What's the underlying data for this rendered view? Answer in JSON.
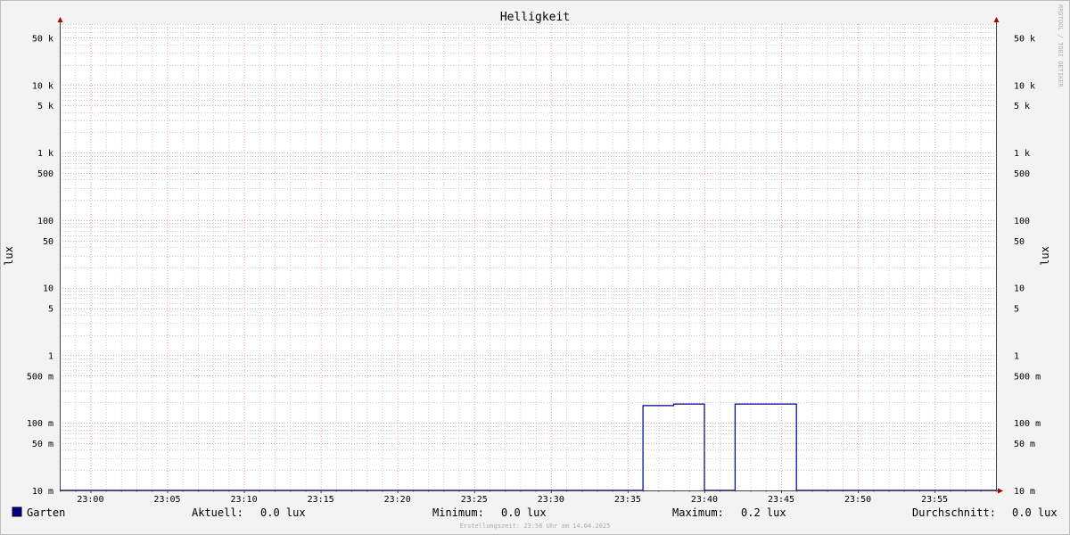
{
  "chart_data": {
    "type": "line",
    "title": "Helligkeit",
    "ylabel_left": "lux",
    "ylabel_right": "lux",
    "y_scale": "log",
    "ylim": [
      0.01,
      80000
    ],
    "xlim": [
      "22:58",
      "23:59"
    ],
    "x_tick_labels": [
      "23:00",
      "23:05",
      "23:10",
      "23:15",
      "23:20",
      "23:25",
      "23:30",
      "23:35",
      "23:40",
      "23:45",
      "23:50",
      "23:55"
    ],
    "y_tick_labels": [
      {
        "value": 50000,
        "label": "50 k"
      },
      {
        "value": 10000,
        "label": "10 k"
      },
      {
        "value": 5000,
        "label": "5 k"
      },
      {
        "value": 1000,
        "label": "1 k"
      },
      {
        "value": 500,
        "label": "500"
      },
      {
        "value": 100,
        "label": "100"
      },
      {
        "value": 50,
        "label": "50"
      },
      {
        "value": 10,
        "label": "10"
      },
      {
        "value": 5,
        "label": "5"
      },
      {
        "value": 1,
        "label": "1"
      },
      {
        "value": 0.5,
        "label": "500 m"
      },
      {
        "value": 0.1,
        "label": "100 m"
      },
      {
        "value": 0.05,
        "label": "50 m"
      },
      {
        "value": 0.01,
        "label": "10 m"
      }
    ],
    "series": [
      {
        "name": "Garten",
        "color": "#00008b",
        "points": [
          [
            "22:58",
            0
          ],
          [
            "23:36",
            0
          ],
          [
            "23:36",
            0.18
          ],
          [
            "23:38",
            0.18
          ],
          [
            "23:38",
            0.19
          ],
          [
            "23:40",
            0.19
          ],
          [
            "23:40",
            0
          ],
          [
            "23:42",
            0
          ],
          [
            "23:42",
            0.19
          ],
          [
            "23:46",
            0.19
          ],
          [
            "23:46",
            0
          ],
          [
            "23:59",
            0
          ]
        ]
      }
    ],
    "grid": true
  },
  "watermark": "RRDTOOL / TOBI OETIKER",
  "legend": {
    "series_name": "Garten",
    "aktuell_label": "Aktuell:",
    "aktuell_value": "0.0 lux",
    "minimum_label": "Minimum:",
    "minimum_value": "0.0 lux",
    "maximum_label": "Maximum:",
    "maximum_value": "0.2 lux",
    "durchschnitt_label": "Durchschnitt:",
    "durchschnitt_value": "0.0 lux"
  },
  "footer": "Erstellungszeit: 23:58 Uhr am 14.04.2025",
  "colors": {
    "background": "#f3f3f3",
    "canvas": "#ffffff",
    "major_grid": "#e8a0a8",
    "minor_grid": "#cccccc",
    "axis": "#444444",
    "arrow": "#aa0000",
    "series": "#00008b"
  }
}
